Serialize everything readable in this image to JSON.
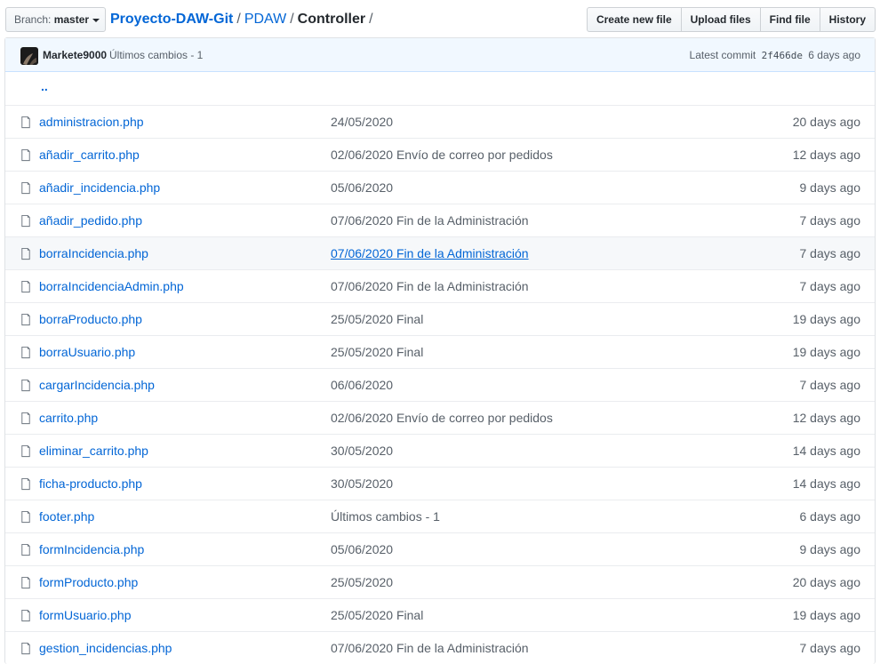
{
  "branch": {
    "prefix": "Branch:",
    "name": "master"
  },
  "breadcrumb": {
    "repo": "Proyecto-DAW-Git",
    "dir1": "PDAW",
    "current": "Controller",
    "sep": "/"
  },
  "actions": {
    "create": "Create new file",
    "upload": "Upload files",
    "find": "Find file",
    "history": "History"
  },
  "commit": {
    "author": "Markete9000",
    "message": "Últimos cambios - 1",
    "latest_label": "Latest commit",
    "sha": "2f466de",
    "age": "6 days ago"
  },
  "parent_link": "..",
  "files": [
    {
      "name": "administracion.php",
      "message": "24/05/2020",
      "age": "20 days ago"
    },
    {
      "name": "añadir_carrito.php",
      "message": "02/06/2020 Envío de correo por pedidos",
      "age": "12 days ago"
    },
    {
      "name": "añadir_incidencia.php",
      "message": "05/06/2020",
      "age": "9 days ago"
    },
    {
      "name": "añadir_pedido.php",
      "message": "07/06/2020 Fin de la Administración",
      "age": "7 days ago"
    },
    {
      "name": "borraIncidencia.php",
      "message": "07/06/2020 Fin de la Administración",
      "age": "7 days ago"
    },
    {
      "name": "borraIncidenciaAdmin.php",
      "message": "07/06/2020 Fin de la Administración",
      "age": "7 days ago"
    },
    {
      "name": "borraProducto.php",
      "message": "25/05/2020 Final",
      "age": "19 days ago"
    },
    {
      "name": "borraUsuario.php",
      "message": "25/05/2020 Final",
      "age": "19 days ago"
    },
    {
      "name": "cargarIncidencia.php",
      "message": "06/06/2020",
      "age": "7 days ago"
    },
    {
      "name": "carrito.php",
      "message": "02/06/2020 Envío de correo por pedidos",
      "age": "12 days ago"
    },
    {
      "name": "eliminar_carrito.php",
      "message": "30/05/2020",
      "age": "14 days ago"
    },
    {
      "name": "ficha-producto.php",
      "message": "30/05/2020",
      "age": "14 days ago"
    },
    {
      "name": "footer.php",
      "message": "Últimos cambios - 1",
      "age": "6 days ago"
    },
    {
      "name": "formIncidencia.php",
      "message": "05/06/2020",
      "age": "9 days ago"
    },
    {
      "name": "formProducto.php",
      "message": "25/05/2020",
      "age": "20 days ago"
    },
    {
      "name": "formUsuario.php",
      "message": "25/05/2020 Final",
      "age": "19 days ago"
    },
    {
      "name": "gestion_incidencias.php",
      "message": "07/06/2020 Fin de la Administración",
      "age": "7 days ago"
    }
  ]
}
